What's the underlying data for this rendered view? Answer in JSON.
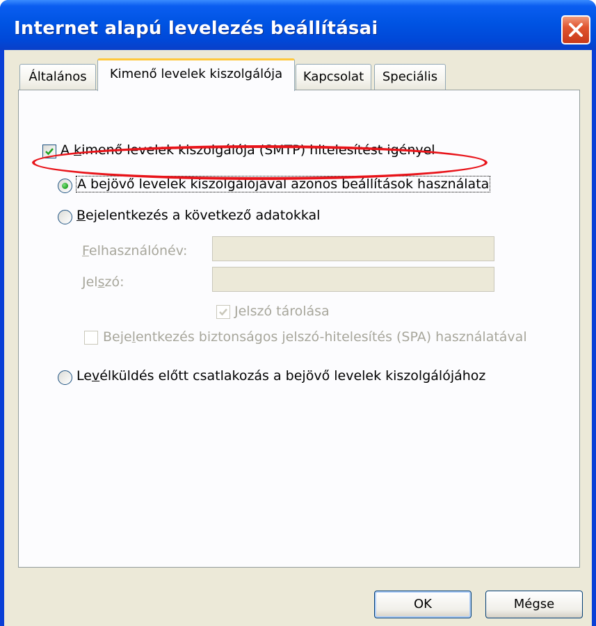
{
  "window": {
    "title": "Internet alapú levelezés beállításai",
    "close_icon": "close-icon"
  },
  "tabs": [
    {
      "label": "Általános",
      "active": false
    },
    {
      "label": "Kimenő levelek kiszolgálója",
      "active": true
    },
    {
      "label": "Kapcsolat",
      "active": false
    },
    {
      "label": "Speciális",
      "active": false
    }
  ],
  "smtp_auth": {
    "checked": true,
    "label_pre": "A ",
    "label_ul": "k",
    "label_post": "imenő levelek kiszolgálója (SMTP) hitelesítést igényel"
  },
  "auth_options": {
    "same_settings": {
      "selected": true,
      "label": "A bejövő levelek kiszolgálójával azonos beállítások használata"
    },
    "login_with": {
      "selected": false,
      "label_ul": "B",
      "label_post": "ejelentkezés a következő adatokkal"
    },
    "username": {
      "label_ul": "F",
      "label_post": "elhasználónév:",
      "value": ""
    },
    "password": {
      "label_pre": "Jel",
      "label_ul": "s",
      "label_post": "zó:",
      "value": ""
    },
    "remember_password": {
      "checked": true,
      "label_ul": "J",
      "label_post": "elszó tárolása"
    },
    "spa": {
      "checked": false,
      "label_pre": "Beje",
      "label_ul": "l",
      "label_post": "entkezés biztonságos jelszó-hitelesítés (SPA) használatával"
    },
    "login_before_send": {
      "selected": false,
      "label_pre": "Le",
      "label_ul": "v",
      "label_post": "élküldés előtt csatlakozás a bejövő levelek kiszolgálójához"
    }
  },
  "buttons": {
    "ok": "OK",
    "cancel": "Mégse"
  },
  "colors": {
    "titlebar": "#0054e3",
    "highlight": "#e8141a",
    "disabled_text": "#a7a69b"
  }
}
